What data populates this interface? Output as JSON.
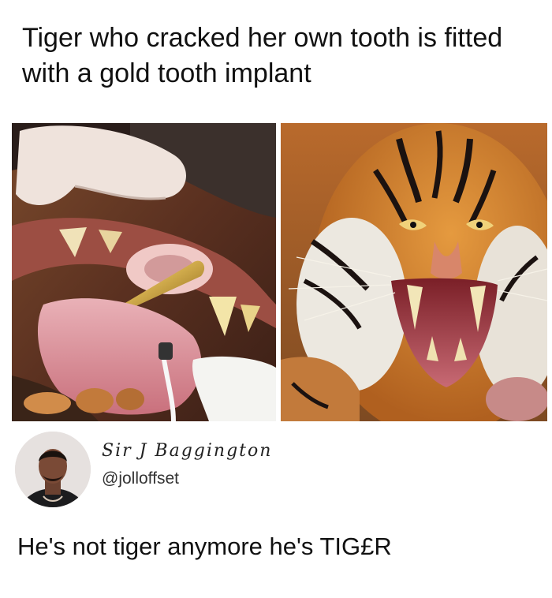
{
  "headline": "Tiger who cracked her own tooth is fitted with a gold tooth implant",
  "photos": {
    "left": {
      "icon": "tiger-gold-tooth-photo"
    },
    "right": {
      "icon": "roaring-tiger-photo"
    }
  },
  "tweet": {
    "display_name": "Sir J Baggington",
    "handle": "@jolloffset",
    "text": "He's not tiger anymore he's TIG£R",
    "avatar_icon": "user-avatar"
  }
}
